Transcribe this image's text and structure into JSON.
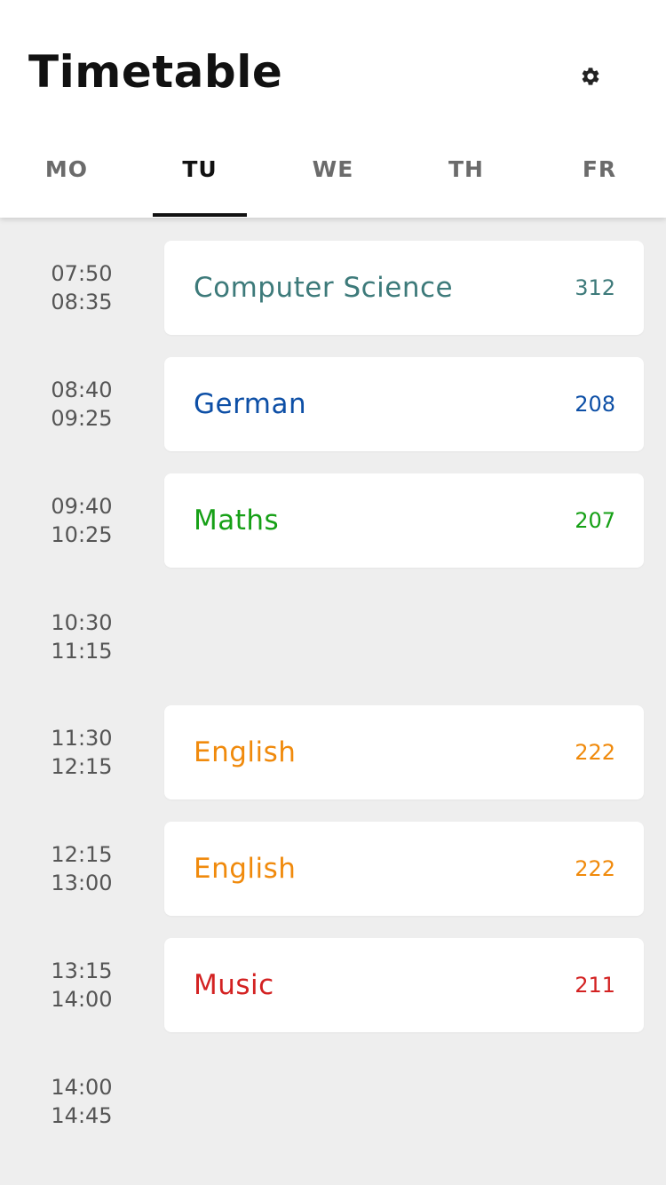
{
  "header": {
    "title": "Timetable",
    "settings_icon": "gear-icon"
  },
  "tabs": [
    {
      "label": "MO",
      "active": false
    },
    {
      "label": "TU",
      "active": true
    },
    {
      "label": "WE",
      "active": false
    },
    {
      "label": "TH",
      "active": false
    },
    {
      "label": "FR",
      "active": false
    }
  ],
  "periods": [
    {
      "start": "07:50",
      "end": "08:35",
      "subject": "Computer Science",
      "room": "312",
      "color": "#3d7a7a"
    },
    {
      "start": "08:40",
      "end": "09:25",
      "subject": "German",
      "room": "208",
      "color": "#0d4fa6"
    },
    {
      "start": "09:40",
      "end": "10:25",
      "subject": "Maths",
      "room": "207",
      "color": "#16a016"
    },
    {
      "start": "10:30",
      "end": "11:15",
      "subject": "",
      "room": "",
      "color": ""
    },
    {
      "start": "11:30",
      "end": "12:15",
      "subject": "English",
      "room": "222",
      "color": "#f08a0c"
    },
    {
      "start": "12:15",
      "end": "13:00",
      "subject": "English",
      "room": "222",
      "color": "#f08a0c"
    },
    {
      "start": "13:15",
      "end": "14:00",
      "subject": "Music",
      "room": "211",
      "color": "#d32222"
    },
    {
      "start": "14:00",
      "end": "14:45",
      "subject": "",
      "room": "",
      "color": ""
    }
  ]
}
